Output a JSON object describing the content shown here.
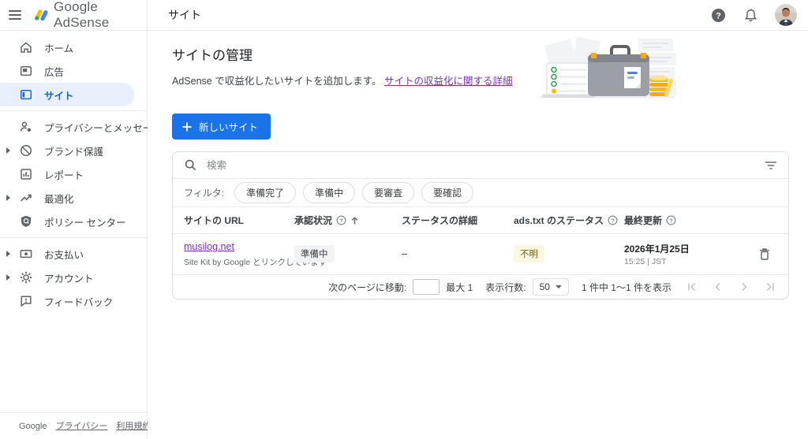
{
  "topbar": {
    "logo_text": "Google AdSense",
    "page_title": "サイト"
  },
  "sidebar": {
    "items": [
      {
        "label": "ホーム"
      },
      {
        "label": "広告"
      },
      {
        "label": "サイト"
      },
      {
        "label": "プライバシーとメッセージ"
      },
      {
        "label": "ブランド保護"
      },
      {
        "label": "レポート"
      },
      {
        "label": "最適化"
      },
      {
        "label": "ポリシー センター"
      },
      {
        "label": "お支払い"
      },
      {
        "label": "アカウント"
      },
      {
        "label": "フィードバック"
      }
    ],
    "footer": {
      "brand": "Google",
      "privacy_link": "プライバシー",
      "terms_link": "利用規約"
    }
  },
  "main": {
    "heading": "サイトの管理",
    "description": "AdSense で収益化したいサイトを追加します。",
    "description_link": "サイトの収益化に関する詳細",
    "new_site_button": "新しいサイト",
    "search_placeholder": "検索",
    "filter_label": "フィルタ:",
    "filter_chips": [
      "準備完了",
      "準備中",
      "要審査",
      "要確認"
    ],
    "table": {
      "headers": [
        "サイトの URL",
        "承認状況",
        "ステータスの詳細",
        "ads.txt のステータス",
        "最終更新"
      ],
      "rows": [
        {
          "url": "musilog.net",
          "url_note": "Site Kit by Google とリンクしています",
          "approval_status": "準備中",
          "status_detail": "–",
          "ads_txt_status": "不明",
          "last_updated_date": "2026年1月25日",
          "last_updated_time": "15:25 | JST"
        }
      ]
    },
    "pagination": {
      "goto_label": "次のページに移動:",
      "goto_value": "",
      "max_label": "最大 1",
      "rows_per_page_label": "表示行数:",
      "rows_per_page_value": "50",
      "range_text": "1 件中 1～1 件を表示"
    }
  },
  "colors": {
    "accent_blue": "#1a73e8",
    "selected_item_bg": "#e8f0fe",
    "selected_item_text": "#1967d2",
    "visited_link_purple": "#7b2fbf",
    "badge_neutral_bg": "#f1f3f4",
    "badge_unknown_bg": "#fef7e0"
  }
}
